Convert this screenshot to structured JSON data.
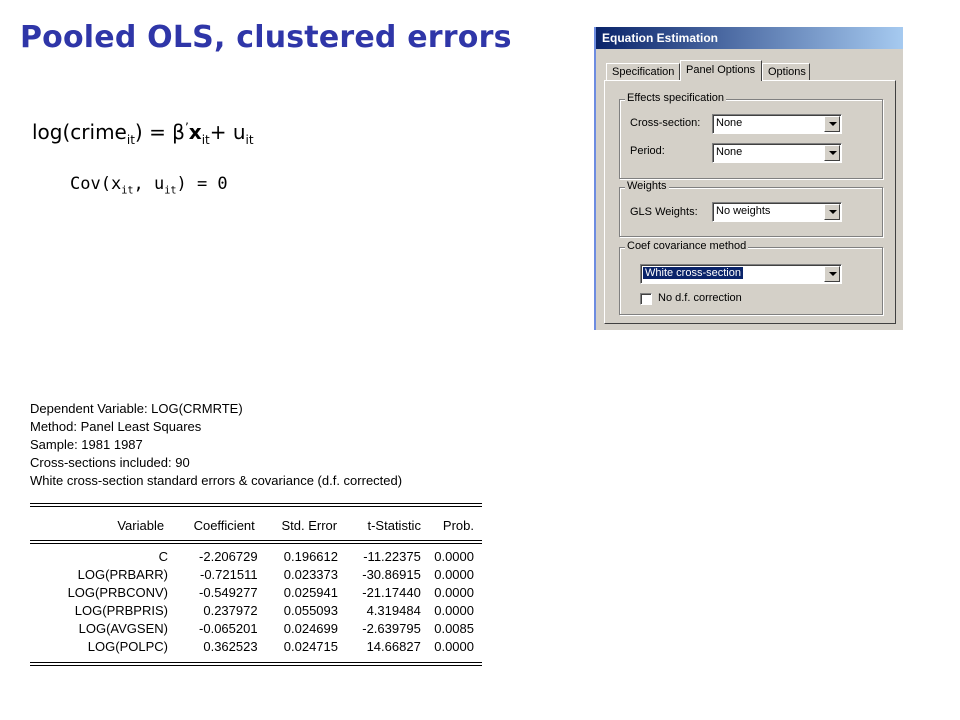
{
  "slide": {
    "title": "Pooled OLS, clustered errors",
    "equation": {
      "lhs_prefix": "log(crime",
      "lhs_sub": "it",
      "lhs_suffix": ") = β",
      "prime": "’",
      "x": "x",
      "x_sub": "it",
      "plus_u": "+ u",
      "u_sub": "it"
    },
    "covariance": {
      "prefix": "Cov(x",
      "sub1": "it",
      "mid": ", u",
      "sub2": "it",
      "suffix": ") = 0"
    }
  },
  "dialog": {
    "title": "Equation Estimation",
    "tabs": [
      "Specification",
      "Panel Options",
      "Options"
    ],
    "active_tab": "Panel Options",
    "effects": {
      "legend": "Effects specification",
      "cross_section_label": "Cross-section:",
      "cross_section_value": "None",
      "period_label": "Period:",
      "period_value": "None"
    },
    "weights": {
      "legend": "Weights",
      "gls_label": "GLS Weights:",
      "gls_value": "No weights"
    },
    "coef_cov": {
      "legend": "Coef covariance method",
      "value": "White cross-section",
      "no_df_label": "No d.f. correction",
      "no_df_checked": false
    }
  },
  "output": {
    "header_lines": [
      "Dependent Variable: LOG(CRMRTE)",
      "Method: Panel Least Squares",
      "Sample: 1981 1987",
      "Cross-sections included: 90",
      "White cross-section standard errors & covariance (d.f. corrected)"
    ],
    "columns": [
      "Variable",
      "Coefficient",
      "Std. Error",
      "t-Statistic",
      "Prob."
    ],
    "rows": [
      [
        "C",
        "-2.206729",
        "0.196612",
        "-11.22375",
        "0.0000"
      ],
      [
        "LOG(PRBARR)",
        "-0.721511",
        "0.023373",
        "-30.86915",
        "0.0000"
      ],
      [
        "LOG(PRBCONV)",
        "-0.549277",
        "0.025941",
        "-21.17440",
        "0.0000"
      ],
      [
        "LOG(PRBPRIS)",
        "0.237972",
        "0.055093",
        "4.319484",
        "0.0000"
      ],
      [
        "LOG(AVGSEN)",
        "-0.065201",
        "0.024699",
        "-2.639795",
        "0.0085"
      ],
      [
        "LOG(POLPC)",
        "0.362523",
        "0.024715",
        "14.66827",
        "0.0000"
      ]
    ]
  }
}
